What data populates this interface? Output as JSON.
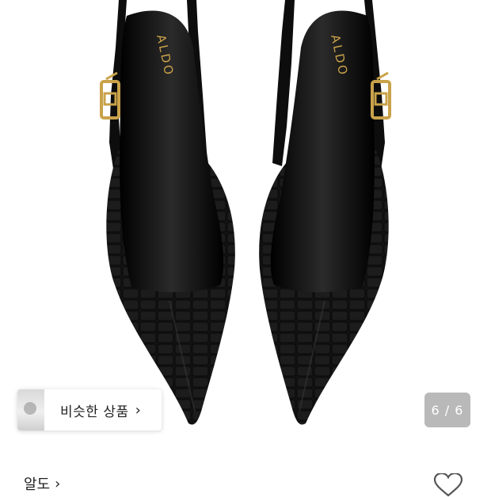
{
  "product_image": {
    "alt_icon": "aldo-slingback-pumps-image",
    "brand_print": "ALDO"
  },
  "similar_products": {
    "label": "비슷한 상품",
    "chevron": "›"
  },
  "pager": {
    "text": "6 / 6"
  },
  "brand_link": {
    "label": "알도",
    "chevron": "›"
  },
  "colors": {
    "leather": "#111111",
    "gold": "#c9a24a",
    "background": "#ffffff"
  }
}
